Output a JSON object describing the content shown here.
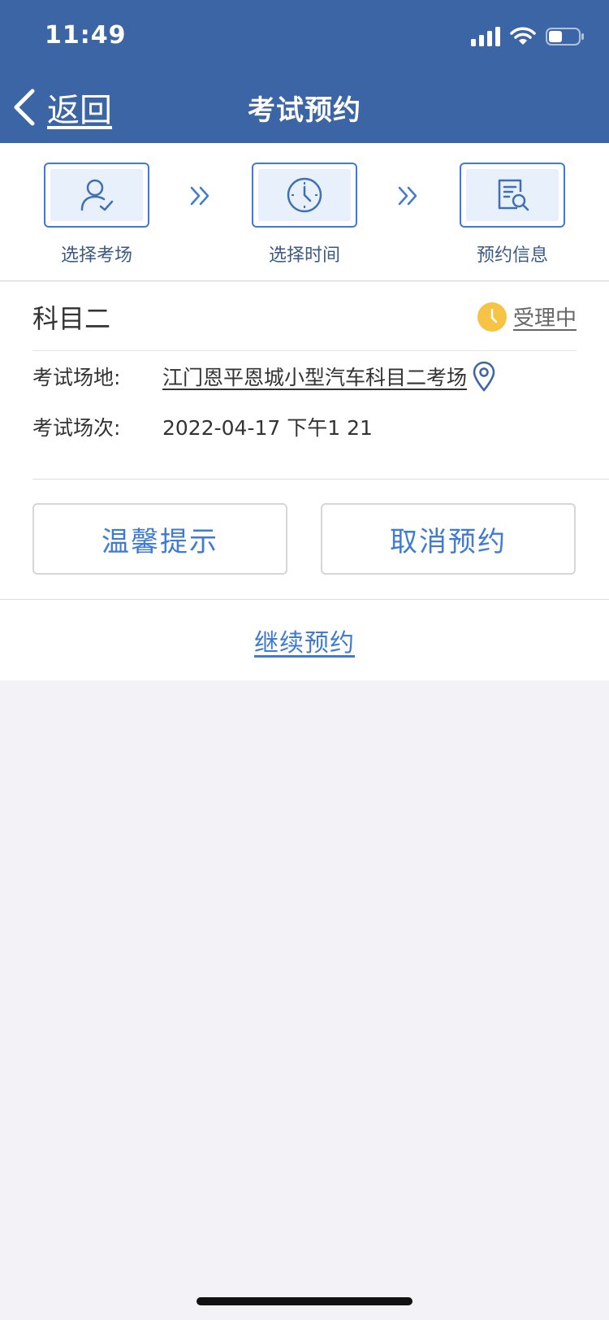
{
  "status_bar": {
    "time": "11:49"
  },
  "nav": {
    "back_label": "返回",
    "title": "考试预约"
  },
  "steps": [
    {
      "label": "选择考场",
      "icon": "user-check-icon"
    },
    {
      "label": "选择时间",
      "icon": "clock-icon"
    },
    {
      "label": "预约信息",
      "icon": "document-search-icon"
    }
  ],
  "card": {
    "subject": "科目二",
    "status": "受理中",
    "venue_label": "考试场地:",
    "venue_value": "江门恩平恩城小型汽车科目二考场",
    "session_label": "考试场次:",
    "session_value": "2022-04-17 下午1 21"
  },
  "actions": {
    "tips_label": "温馨提示",
    "cancel_label": "取消预约",
    "continue_label": "继续预约"
  },
  "colors": {
    "header_bg": "#3b65a5",
    "accent": "#3f7bd1",
    "status_yellow": "#f6c344",
    "page_bg": "#f2f2f7"
  }
}
